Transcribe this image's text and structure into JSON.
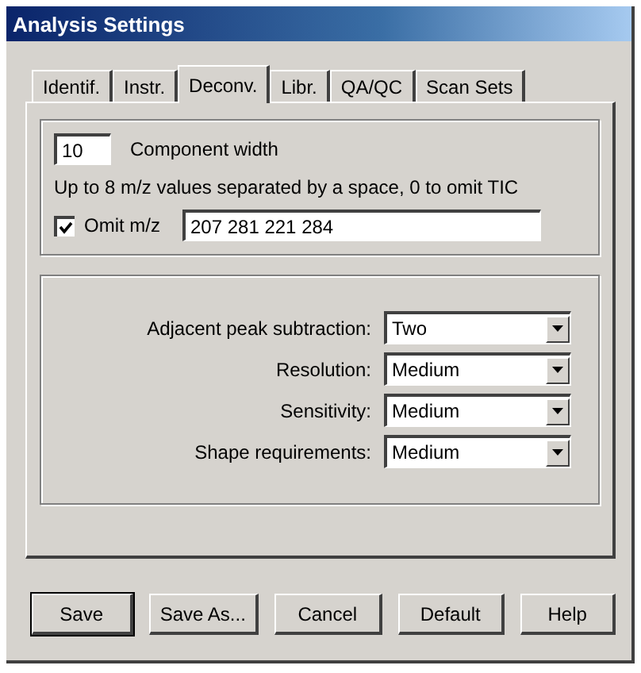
{
  "window": {
    "title": "Analysis Settings"
  },
  "tabs": [
    {
      "label": "Identif.",
      "selected": false
    },
    {
      "label": "Instr.",
      "selected": false
    },
    {
      "label": "Deconv.",
      "selected": true
    },
    {
      "label": "Libr.",
      "selected": false
    },
    {
      "label": "QA/QC",
      "selected": false
    },
    {
      "label": "Scan Sets",
      "selected": false
    }
  ],
  "component_width": {
    "value": "10",
    "label": "Component width"
  },
  "hint": "Up to 8 m/z values separated by a space, 0 to omit TIC",
  "omit_mz": {
    "label": "Omit m/z",
    "checked": true,
    "value": "207 281 221 284"
  },
  "settings": [
    {
      "label": "Adjacent peak subtraction:",
      "value": "Two"
    },
    {
      "label": "Resolution:",
      "value": "Medium"
    },
    {
      "label": "Sensitivity:",
      "value": "Medium"
    },
    {
      "label": "Shape requirements:",
      "value": "Medium"
    }
  ],
  "buttons": [
    {
      "label": "Save",
      "default": true
    },
    {
      "label": "Save As...",
      "default": false
    },
    {
      "label": "Cancel",
      "default": false
    },
    {
      "label": "Default",
      "default": false
    },
    {
      "label": "Help",
      "default": false
    }
  ]
}
